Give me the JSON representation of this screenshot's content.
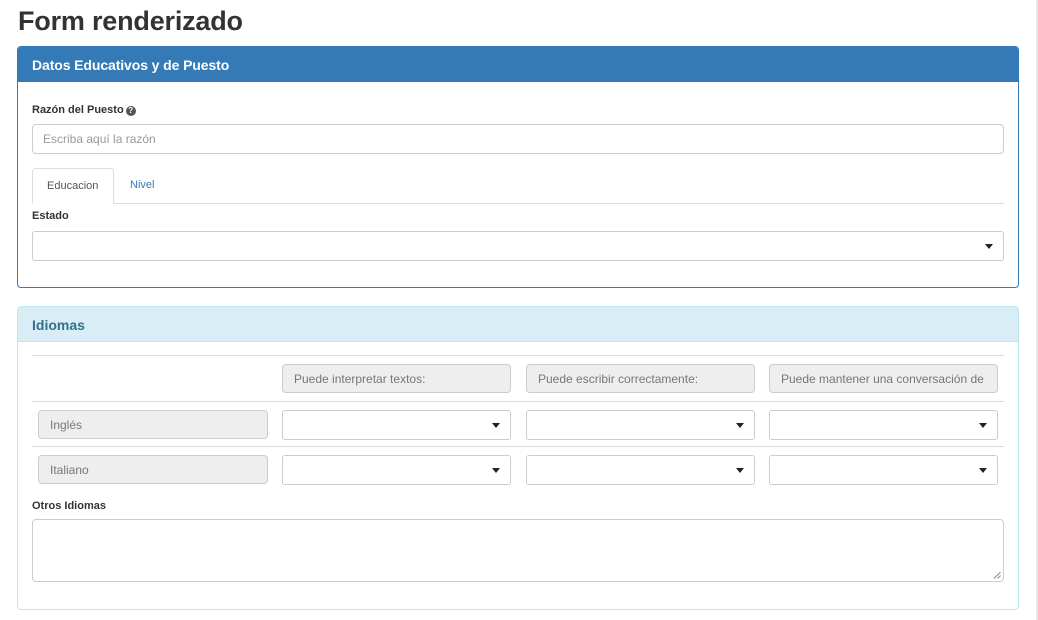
{
  "page": {
    "title": "Form renderizado"
  },
  "education_panel": {
    "header": "Datos Educativos y de Puesto",
    "reason_label": "Razón del Puesto",
    "reason_placeholder": "Escriba aquí la razón",
    "help_icon": "question-circle-icon",
    "tabs": [
      {
        "label": "Educacion",
        "active": true
      },
      {
        "label": "Nivel",
        "active": false
      }
    ],
    "state_label": "Estado",
    "state_value": ""
  },
  "languages_panel": {
    "header": "Idiomas",
    "columns": [
      "Puede interpretar textos:",
      "Puede escribir correctamente:",
      "Puede mantener una conversación de"
    ],
    "rows": [
      {
        "language": "Inglés",
        "values": [
          "",
          "",
          ""
        ]
      },
      {
        "language": "Italiano",
        "values": [
          "",
          "",
          ""
        ]
      }
    ],
    "other_label": "Otros Idiomas",
    "other_value": ""
  },
  "colors": {
    "primary": "#337ab7",
    "info_bg": "#d9edf7",
    "info_border": "#bce8f1",
    "info_text": "#31708f"
  }
}
